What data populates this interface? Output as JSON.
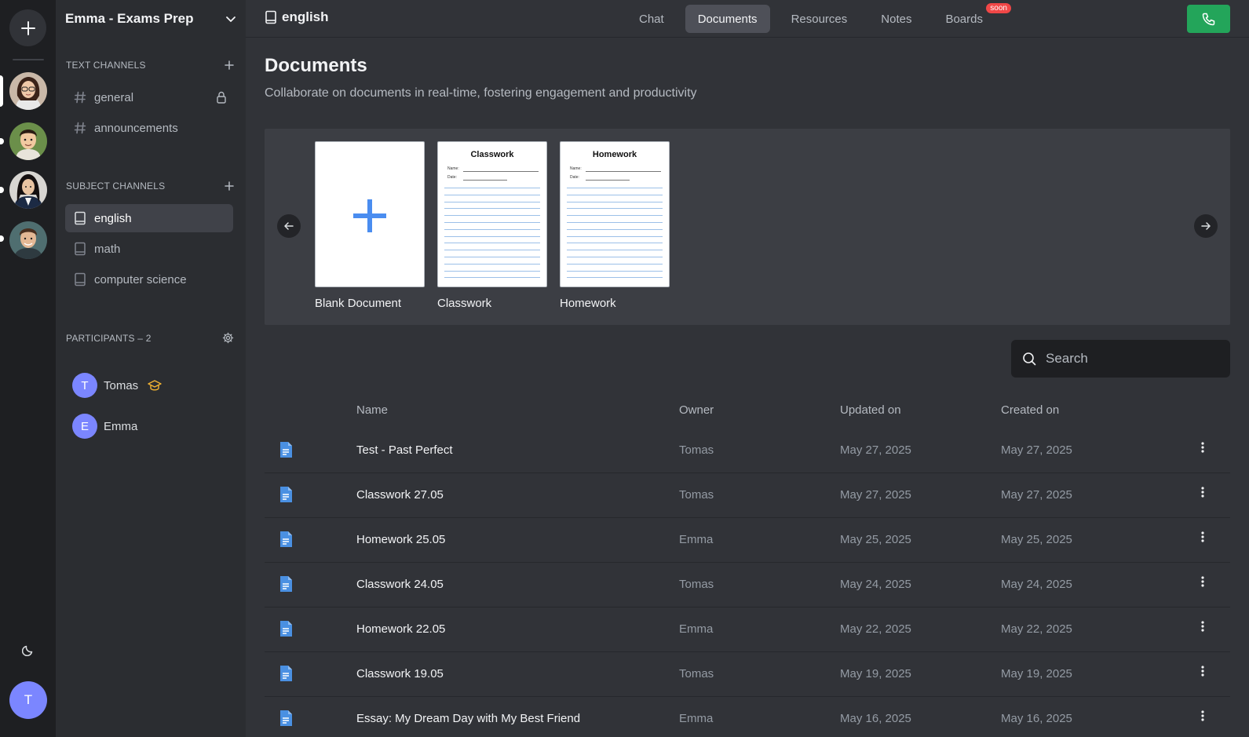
{
  "server": {
    "name": "Emma - Exams Prep"
  },
  "sections": {
    "text_channels": "TEXT CHANNELS",
    "subject_channels": "SUBJECT CHANNELS",
    "participants": "PARTICIPANTS – 2"
  },
  "text_channels": [
    {
      "name": "general",
      "locked": true
    },
    {
      "name": "announcements",
      "locked": false
    }
  ],
  "subject_channels": [
    {
      "name": "english",
      "active": true
    },
    {
      "name": "math",
      "active": false
    },
    {
      "name": "computer science",
      "active": false
    }
  ],
  "participants": [
    {
      "initial": "T",
      "name": "Tomas",
      "badge": "graduation-cap-icon"
    },
    {
      "initial": "E",
      "name": "Emma"
    }
  ],
  "user": {
    "initial": "T"
  },
  "topbar": {
    "channel": "english",
    "tabs": [
      {
        "label": "Chat",
        "active": false
      },
      {
        "label": "Documents",
        "active": true
      },
      {
        "label": "Resources",
        "active": false
      },
      {
        "label": "Notes",
        "active": false
      },
      {
        "label": "Boards",
        "active": false,
        "badge": "soon"
      }
    ]
  },
  "page": {
    "title": "Documents",
    "subtitle": "Collaborate on documents in real-time, fostering engagement and productivity"
  },
  "templates": [
    {
      "label": "Blank Document",
      "kind": "blank"
    },
    {
      "label": "Classwork",
      "kind": "paper",
      "paper_title": "Classwork",
      "field_name": "Name:",
      "field_date": "Date:"
    },
    {
      "label": "Homework",
      "kind": "paper",
      "paper_title": "Homework",
      "field_name": "Name:",
      "field_date": "Date:"
    }
  ],
  "search": {
    "placeholder": "Search"
  },
  "table": {
    "headers": {
      "name": "Name",
      "owner": "Owner",
      "updated": "Updated on",
      "created": "Created on"
    },
    "rows": [
      {
        "name": "Test - Past Perfect",
        "owner": "Tomas",
        "updated": "May 27, 2025",
        "created": "May 27, 2025"
      },
      {
        "name": "Classwork 27.05",
        "owner": "Tomas",
        "updated": "May 27, 2025",
        "created": "May 27, 2025"
      },
      {
        "name": "Homework 25.05",
        "owner": "Emma",
        "updated": "May 25, 2025",
        "created": "May 25, 2025"
      },
      {
        "name": "Classwork 24.05",
        "owner": "Tomas",
        "updated": "May 24, 2025",
        "created": "May 24, 2025"
      },
      {
        "name": "Homework 22.05",
        "owner": "Emma",
        "updated": "May 22, 2025",
        "created": "May 22, 2025"
      },
      {
        "name": "Classwork 19.05",
        "owner": "Tomas",
        "updated": "May 19, 2025",
        "created": "May 19, 2025"
      },
      {
        "name": "Essay: My Dream Day with My Best Friend",
        "owner": "Emma",
        "updated": "May 16, 2025",
        "created": "May 16, 2025"
      }
    ]
  },
  "colors": {
    "accent": "#7b86ff",
    "call_green": "#23a55a",
    "doc_icon_blue": "#4a90e2",
    "soon_badge": "#f04747",
    "plus_blue": "#4a8df0"
  }
}
